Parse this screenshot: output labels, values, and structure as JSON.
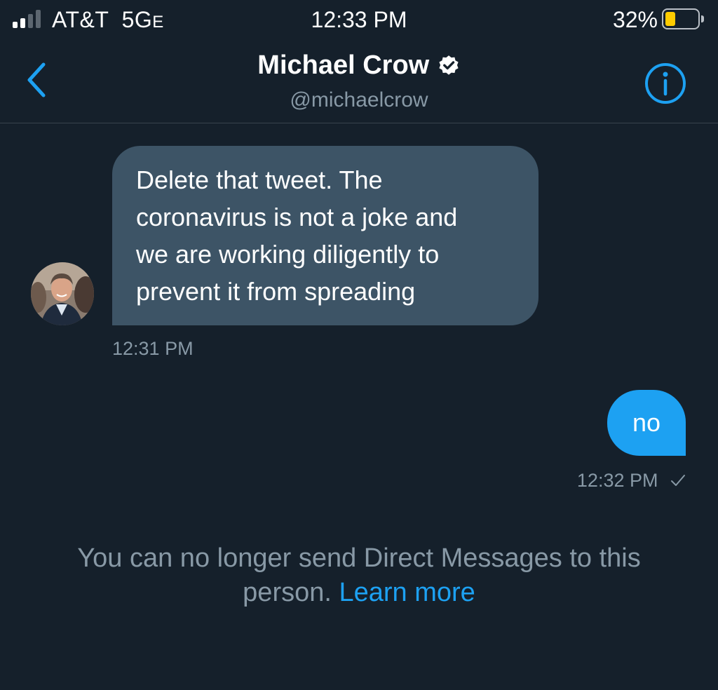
{
  "status_bar": {
    "carrier": "AT&T",
    "network": "5G",
    "network_suffix": "E",
    "time": "12:33 PM",
    "battery_percent": "32%",
    "battery_level": 0.32,
    "signal_bars_filled": 2,
    "signal_bars_total": 4
  },
  "header": {
    "name": "Michael Crow",
    "handle": "@michaelcrow",
    "verified": true,
    "back_icon": "chevron-left-icon",
    "info_icon": "info-circle-icon"
  },
  "messages": [
    {
      "direction": "incoming",
      "text": "Delete that tweet. The coronavirus is not a joke and we are working diligently to prevent it from spreading",
      "lines": [
        "Delete that tweet. The",
        "coronavirus is not a joke and",
        "we are working diligently to",
        "prevent it from spreading"
      ],
      "time": "12:31 PM"
    },
    {
      "direction": "outgoing",
      "text": "no",
      "time": "12:32 PM",
      "status_icon": "check-icon"
    }
  ],
  "notice": {
    "text_line1": "You can no longer send Direct Messages to this",
    "text_line2": "person.",
    "link": "Learn more"
  },
  "colors": {
    "background": "#15202b",
    "incoming_bubble": "#3d5466",
    "outgoing_bubble": "#1da1f2",
    "accent": "#1da1f2",
    "muted_text": "#8899a6",
    "battery": "#ffcc00"
  }
}
